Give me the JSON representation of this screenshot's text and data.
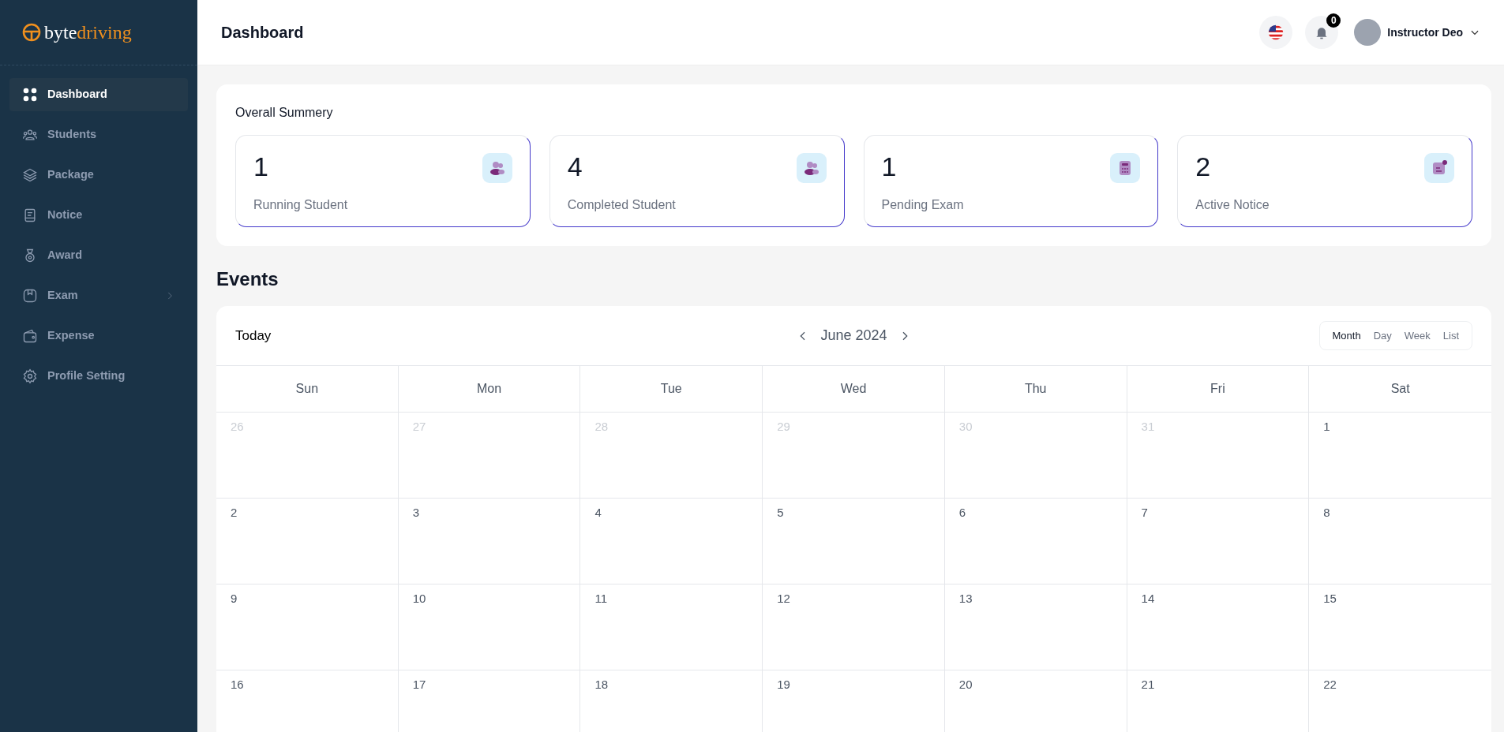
{
  "logo": {
    "part_1": "byte",
    "part_2": "driving"
  },
  "sidebar": {
    "items": [
      {
        "label": "Dashboard",
        "selected": true,
        "expandable": false
      },
      {
        "label": "Students",
        "selected": false,
        "expandable": false
      },
      {
        "label": "Package",
        "selected": false,
        "expandable": false
      },
      {
        "label": "Notice",
        "selected": false,
        "expandable": false
      },
      {
        "label": "Award",
        "selected": false,
        "expandable": false
      },
      {
        "label": "Exam",
        "selected": false,
        "expandable": true
      },
      {
        "label": "Expense",
        "selected": false,
        "expandable": false
      },
      {
        "label": "Profile Setting",
        "selected": false,
        "expandable": false
      }
    ]
  },
  "header": {
    "title": "Dashboard",
    "notification_count": "0",
    "user_name": "Instructor Deo"
  },
  "summary": {
    "title": "Overall Summery",
    "cards": [
      {
        "value": "1",
        "label": "Running Student"
      },
      {
        "value": "4",
        "label": "Completed Student"
      },
      {
        "value": "1",
        "label": "Pending Exam"
      },
      {
        "value": "2",
        "label": "Active Notice"
      }
    ]
  },
  "events": {
    "title": "Events",
    "today": "Today",
    "month": "June 2024",
    "views": [
      {
        "label": "Month",
        "selected": true
      },
      {
        "label": "Day",
        "selected": false
      },
      {
        "label": "Week",
        "selected": false
      },
      {
        "label": "List",
        "selected": false
      }
    ],
    "weekdays": [
      "Sun",
      "Mon",
      "Tue",
      "Wed",
      "Thu",
      "Fri",
      "Sat"
    ],
    "weeks": [
      [
        {
          "day": "26",
          "muted": true
        },
        {
          "day": "27",
          "muted": true
        },
        {
          "day": "28",
          "muted": true
        },
        {
          "day": "29",
          "muted": true
        },
        {
          "day": "30",
          "muted": true
        },
        {
          "day": "31",
          "muted": true
        },
        {
          "day": "1",
          "muted": false
        }
      ],
      [
        {
          "day": "2",
          "muted": false
        },
        {
          "day": "3",
          "muted": false
        },
        {
          "day": "4",
          "muted": false
        },
        {
          "day": "5",
          "muted": false
        },
        {
          "day": "6",
          "muted": false
        },
        {
          "day": "7",
          "muted": false
        },
        {
          "day": "8",
          "muted": false
        }
      ],
      [
        {
          "day": "9",
          "muted": false
        },
        {
          "day": "10",
          "muted": false
        },
        {
          "day": "11",
          "muted": false
        },
        {
          "day": "12",
          "muted": false
        },
        {
          "day": "13",
          "muted": false
        },
        {
          "day": "14",
          "muted": false
        },
        {
          "day": "15",
          "muted": false
        }
      ],
      [
        {
          "day": "16",
          "muted": false
        },
        {
          "day": "17",
          "muted": false
        },
        {
          "day": "18",
          "muted": false
        },
        {
          "day": "19",
          "muted": false
        },
        {
          "day": "20",
          "muted": false
        },
        {
          "day": "21",
          "muted": false
        },
        {
          "day": "22",
          "muted": false
        }
      ]
    ]
  }
}
